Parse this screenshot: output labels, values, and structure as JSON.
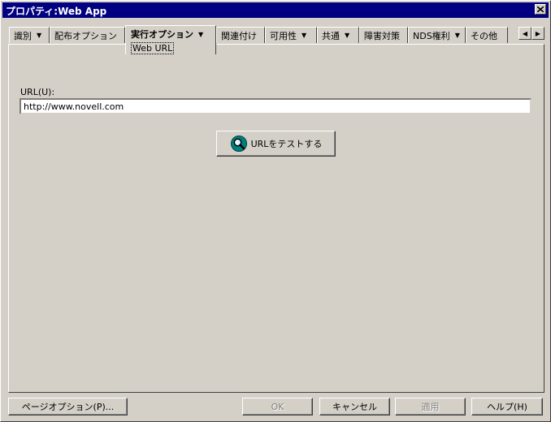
{
  "window": {
    "title": "プロパティ:Web App"
  },
  "tabs": [
    {
      "label": "識別",
      "caret": true
    },
    {
      "label": "配布オプション",
      "caret": false
    },
    {
      "label": "実行オプション",
      "caret": true,
      "active": true,
      "sub_label": "Web URL"
    },
    {
      "label": "関連付け",
      "caret": false
    },
    {
      "label": "可用性",
      "caret": true
    },
    {
      "label": "共通",
      "caret": true
    },
    {
      "label": "障害対策",
      "caret": false
    },
    {
      "label": "NDS権利",
      "caret": true
    },
    {
      "label": "その他",
      "caret": false
    }
  ],
  "main": {
    "url_label": "URL(U):",
    "url_value": "http://www.novell.com",
    "test_button": "URLをテストする"
  },
  "footer": {
    "page_options": "ページオプション(P)...",
    "ok": "OK",
    "cancel": "キャンセル",
    "apply": "適用",
    "help": "ヘルプ(H)"
  },
  "colors": {
    "titlebar": "#000080",
    "face": "#d4d0c8"
  }
}
